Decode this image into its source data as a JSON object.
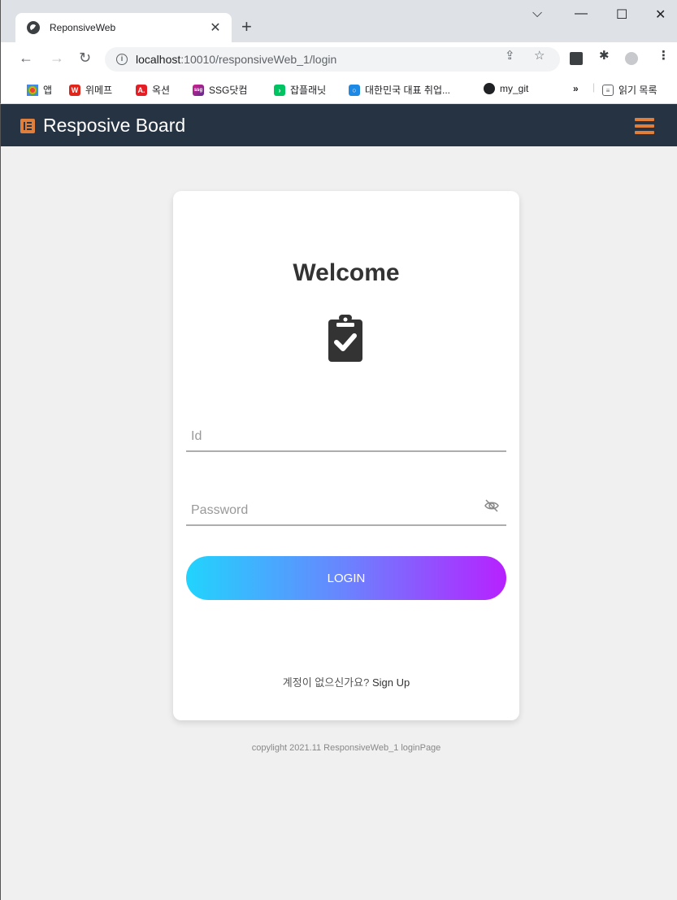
{
  "browser": {
    "tab_title": "ReponsiveWeb",
    "url_host": "localhost",
    "url_path": ":10010/responsiveWeb_1/login",
    "bookmarks": [
      {
        "label": "앱",
        "color": "#ea4335",
        "glyph": ""
      },
      {
        "label": "위메프",
        "color": "#e1251b",
        "glyph": "W"
      },
      {
        "label": "옥션",
        "color": "#e31e24",
        "glyph": "A."
      },
      {
        "label": "SSG닷컴",
        "color": "#d61e8c",
        "glyph": "ssg"
      },
      {
        "label": "잡플래닛",
        "color": "#00c362",
        "glyph": "›"
      },
      {
        "label": "대한민국 대표 취업...",
        "color": "#1e88e5",
        "glyph": "○"
      },
      {
        "label": "my_git",
        "color": "#202124",
        "glyph": "●"
      }
    ],
    "more_bookmarks": "»",
    "reading_list": "읽기 목록"
  },
  "navbar": {
    "brand": "Resposive Board",
    "brand_color": "#e07e3c",
    "bg_color": "#263343"
  },
  "login": {
    "heading": "Welcome",
    "id_placeholder": "Id",
    "password_placeholder": "Password",
    "login_label": "LOGIN",
    "signup_prompt": "계정이 없으신가요? ",
    "signup_link": "Sign Up"
  },
  "footer": {
    "copyright": "copylight 2021.11 ResponsiveWeb_1 loginPage"
  }
}
